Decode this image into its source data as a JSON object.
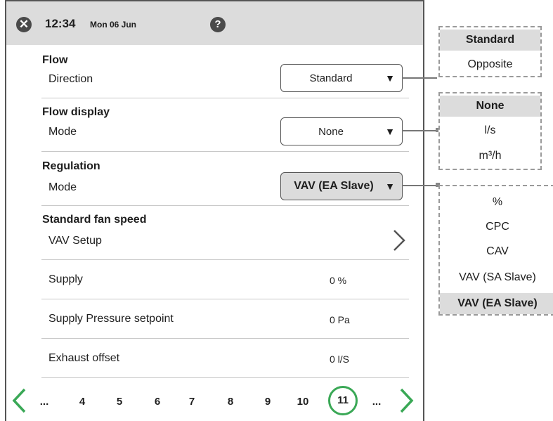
{
  "header": {
    "time": "12:34",
    "date": "Mon 06 Jun",
    "close_icon": "close-icon",
    "help_glyph": "?"
  },
  "sections": {
    "flow": {
      "title": "Flow",
      "label": "Direction",
      "value": "Standard"
    },
    "flow_display": {
      "title": "Flow display",
      "label": "Mode",
      "value": "None"
    },
    "regulation": {
      "title": "Regulation",
      "label": "Mode",
      "value": "VAV (EA Slave)"
    },
    "fan_speed": {
      "title": "Standard fan speed",
      "label": "VAV Setup"
    }
  },
  "rows": [
    {
      "label": "Supply",
      "value": "0 %"
    },
    {
      "label": "Supply Pressure setpoint",
      "value": "0 Pa"
    },
    {
      "label": "Exhaust offset",
      "value": "0 l/S"
    }
  ],
  "pager": {
    "pages": [
      "...",
      "4",
      "5",
      "6",
      "7",
      "8",
      "9",
      "10"
    ],
    "current": "11",
    "end": "..."
  },
  "popups": {
    "direction_options": [
      "Standard",
      "Opposite"
    ],
    "direction_selected": "Standard",
    "display_options": [
      "None",
      "l/s",
      "m³/h"
    ],
    "display_selected": "None",
    "regulation_options": [
      "%",
      "CPC",
      "CAV",
      "VAV (SA Slave)",
      "VAV (EA Slave)"
    ],
    "regulation_selected": "VAV (EA Slave)"
  },
  "colors": {
    "header_bg": "#dcdcdc",
    "accent_green": "#3aa856",
    "selected_bg": "#dcdcdc",
    "border": "#555555"
  }
}
